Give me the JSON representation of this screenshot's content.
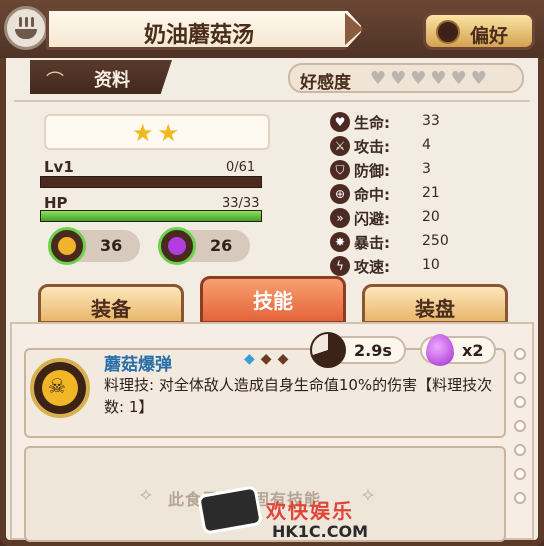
{
  "header": {
    "title": "奶油蘑菇汤",
    "preference_label": "偏好"
  },
  "info_tab": {
    "label": "资料"
  },
  "affection": {
    "label": "好感度",
    "hearts_total": 6,
    "hearts_filled": 0
  },
  "character": {
    "stars": 2,
    "stars_text": "★★",
    "level_label": "Lv1",
    "exp_text": "0/61",
    "exp_fraction": 0.0,
    "hp_label": "HP",
    "hp_text": "33/33",
    "hp_fraction": 1.0,
    "resource1_value": "36",
    "resource2_value": "26"
  },
  "stats": [
    {
      "name": "生命:",
      "value": "33",
      "icon": "heart-icon"
    },
    {
      "name": "攻击:",
      "value": "4",
      "icon": "attack-icon"
    },
    {
      "name": "防御:",
      "value": "3",
      "icon": "shield-icon"
    },
    {
      "name": "命中:",
      "value": "21",
      "icon": "crosshair-icon"
    },
    {
      "name": "闪避:",
      "value": "20",
      "icon": "dodge-icon"
    },
    {
      "name": "暴击:",
      "value": "250",
      "icon": "crit-icon"
    },
    {
      "name": "攻速:",
      "value": "10",
      "icon": "speed-icon"
    }
  ],
  "tabs": [
    {
      "label": "装备"
    },
    {
      "label": "技能"
    },
    {
      "label": "装盘"
    }
  ],
  "skill": {
    "name": "蘑菇爆弹",
    "cooldown": "2.9s",
    "cost": "x2",
    "description": "料理技: 对全体敌人造成自身生命值10%的伤害【料理技次数: 1】"
  },
  "empty_slot_text": "此食灵没有固有技能",
  "watermark": {
    "line1": "欢快娱乐",
    "line2": "HK1C.COM"
  },
  "colors": {
    "hp": "#3ea12a",
    "active_tab": "#e4643a",
    "skill_name": "#2a6fa8",
    "star": "#f0b91d"
  }
}
